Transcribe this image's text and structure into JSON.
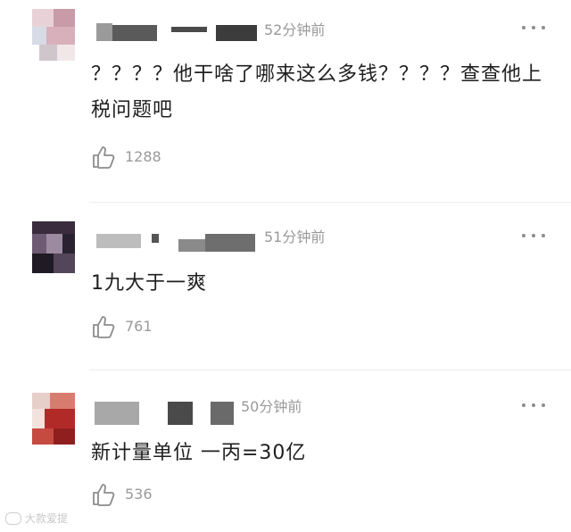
{
  "comments": [
    {
      "time": "52分钟前",
      "text": "？？？？他干啥了哪来这么多钱？？？？查查他上税问题吧",
      "likes": "1288",
      "avatar_colors": [
        "#d8b8c2",
        "#c99aa8",
        "#e9d8dc",
        "#b88a98",
        "#cfd4de",
        "#e5c2c8"
      ]
    },
    {
      "time": "51分钟前",
      "text": "1九大于一爽",
      "likes": "761",
      "avatar_colors": [
        "#2a1f2c",
        "#4a3848",
        "#7b6a80",
        "#1e1a22",
        "#5a4f63",
        "#8c7b8e"
      ]
    },
    {
      "time": "50分钟前",
      "text": "新计量单位 一丙=30亿",
      "likes": "536",
      "avatar_colors": [
        "#b8312f",
        "#e2b8b0",
        "#f3e6e2",
        "#8e1f1f",
        "#d68b80",
        "#c44a3e"
      ]
    }
  ],
  "watermark": "大款爱提"
}
